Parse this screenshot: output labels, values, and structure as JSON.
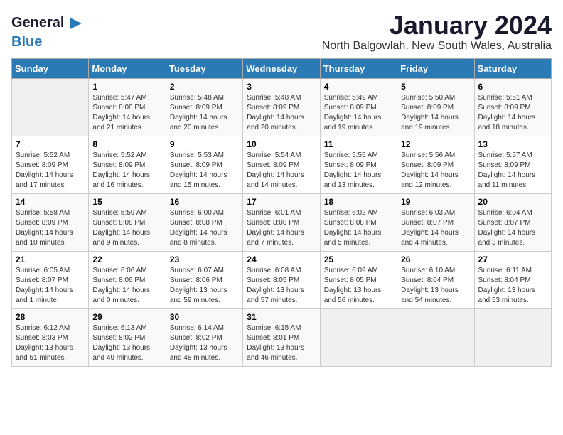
{
  "logo": {
    "line1": "General",
    "line2": "Blue",
    "arrow": "▶"
  },
  "title": "January 2024",
  "subtitle": "North Balgowlah, New South Wales, Australia",
  "headers": [
    "Sunday",
    "Monday",
    "Tuesday",
    "Wednesday",
    "Thursday",
    "Friday",
    "Saturday"
  ],
  "weeks": [
    [
      {
        "day": "",
        "info": ""
      },
      {
        "day": "1",
        "info": "Sunrise: 5:47 AM\nSunset: 8:08 PM\nDaylight: 14 hours\nand 21 minutes."
      },
      {
        "day": "2",
        "info": "Sunrise: 5:48 AM\nSunset: 8:09 PM\nDaylight: 14 hours\nand 20 minutes."
      },
      {
        "day": "3",
        "info": "Sunrise: 5:48 AM\nSunset: 8:09 PM\nDaylight: 14 hours\nand 20 minutes."
      },
      {
        "day": "4",
        "info": "Sunrise: 5:49 AM\nSunset: 8:09 PM\nDaylight: 14 hours\nand 19 minutes."
      },
      {
        "day": "5",
        "info": "Sunrise: 5:50 AM\nSunset: 8:09 PM\nDaylight: 14 hours\nand 19 minutes."
      },
      {
        "day": "6",
        "info": "Sunrise: 5:51 AM\nSunset: 8:09 PM\nDaylight: 14 hours\nand 18 minutes."
      }
    ],
    [
      {
        "day": "7",
        "info": "Sunrise: 5:52 AM\nSunset: 8:09 PM\nDaylight: 14 hours\nand 17 minutes."
      },
      {
        "day": "8",
        "info": "Sunrise: 5:52 AM\nSunset: 8:09 PM\nDaylight: 14 hours\nand 16 minutes."
      },
      {
        "day": "9",
        "info": "Sunrise: 5:53 AM\nSunset: 8:09 PM\nDaylight: 14 hours\nand 15 minutes."
      },
      {
        "day": "10",
        "info": "Sunrise: 5:54 AM\nSunset: 8:09 PM\nDaylight: 14 hours\nand 14 minutes."
      },
      {
        "day": "11",
        "info": "Sunrise: 5:55 AM\nSunset: 8:09 PM\nDaylight: 14 hours\nand 13 minutes."
      },
      {
        "day": "12",
        "info": "Sunrise: 5:56 AM\nSunset: 8:09 PM\nDaylight: 14 hours\nand 12 minutes."
      },
      {
        "day": "13",
        "info": "Sunrise: 5:57 AM\nSunset: 8:09 PM\nDaylight: 14 hours\nand 11 minutes."
      }
    ],
    [
      {
        "day": "14",
        "info": "Sunrise: 5:58 AM\nSunset: 8:09 PM\nDaylight: 14 hours\nand 10 minutes."
      },
      {
        "day": "15",
        "info": "Sunrise: 5:59 AM\nSunset: 8:08 PM\nDaylight: 14 hours\nand 9 minutes."
      },
      {
        "day": "16",
        "info": "Sunrise: 6:00 AM\nSunset: 8:08 PM\nDaylight: 14 hours\nand 8 minutes."
      },
      {
        "day": "17",
        "info": "Sunrise: 6:01 AM\nSunset: 8:08 PM\nDaylight: 14 hours\nand 7 minutes."
      },
      {
        "day": "18",
        "info": "Sunrise: 6:02 AM\nSunset: 8:08 PM\nDaylight: 14 hours\nand 5 minutes."
      },
      {
        "day": "19",
        "info": "Sunrise: 6:03 AM\nSunset: 8:07 PM\nDaylight: 14 hours\nand 4 minutes."
      },
      {
        "day": "20",
        "info": "Sunrise: 6:04 AM\nSunset: 8:07 PM\nDaylight: 14 hours\nand 3 minutes."
      }
    ],
    [
      {
        "day": "21",
        "info": "Sunrise: 6:05 AM\nSunset: 8:07 PM\nDaylight: 14 hours\nand 1 minute."
      },
      {
        "day": "22",
        "info": "Sunrise: 6:06 AM\nSunset: 8:06 PM\nDaylight: 14 hours\nand 0 minutes."
      },
      {
        "day": "23",
        "info": "Sunrise: 6:07 AM\nSunset: 8:06 PM\nDaylight: 13 hours\nand 59 minutes."
      },
      {
        "day": "24",
        "info": "Sunrise: 6:08 AM\nSunset: 8:05 PM\nDaylight: 13 hours\nand 57 minutes."
      },
      {
        "day": "25",
        "info": "Sunrise: 6:09 AM\nSunset: 8:05 PM\nDaylight: 13 hours\nand 56 minutes."
      },
      {
        "day": "26",
        "info": "Sunrise: 6:10 AM\nSunset: 8:04 PM\nDaylight: 13 hours\nand 54 minutes."
      },
      {
        "day": "27",
        "info": "Sunrise: 6:11 AM\nSunset: 8:04 PM\nDaylight: 13 hours\nand 53 minutes."
      }
    ],
    [
      {
        "day": "28",
        "info": "Sunrise: 6:12 AM\nSunset: 8:03 PM\nDaylight: 13 hours\nand 51 minutes."
      },
      {
        "day": "29",
        "info": "Sunrise: 6:13 AM\nSunset: 8:02 PM\nDaylight: 13 hours\nand 49 minutes."
      },
      {
        "day": "30",
        "info": "Sunrise: 6:14 AM\nSunset: 8:02 PM\nDaylight: 13 hours\nand 48 minutes."
      },
      {
        "day": "31",
        "info": "Sunrise: 6:15 AM\nSunset: 8:01 PM\nDaylight: 13 hours\nand 46 minutes."
      },
      {
        "day": "",
        "info": ""
      },
      {
        "day": "",
        "info": ""
      },
      {
        "day": "",
        "info": ""
      }
    ]
  ]
}
